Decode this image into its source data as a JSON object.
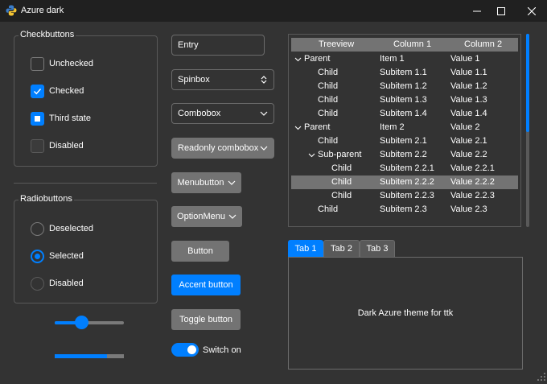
{
  "window": {
    "title": "Azure dark",
    "minimize": "—",
    "maximize": "☐",
    "close": "✕"
  },
  "checkbuttons": {
    "label": "Checkbuttons",
    "items": [
      {
        "label": "Unchecked",
        "state": "unchecked"
      },
      {
        "label": "Checked",
        "state": "checked"
      },
      {
        "label": "Third state",
        "state": "indeterminate"
      },
      {
        "label": "Disabled",
        "state": "disabled"
      }
    ]
  },
  "radiobuttons": {
    "label": "Radiobuttons",
    "items": [
      {
        "label": "Deselected",
        "state": "off"
      },
      {
        "label": "Selected",
        "state": "on"
      },
      {
        "label": "Disabled",
        "state": "disabled"
      }
    ]
  },
  "scale": {
    "value_fraction": 0.3
  },
  "progress": {
    "value_fraction": 0.75
  },
  "widgets": {
    "entry": "Entry",
    "spinbox": "Spinbox",
    "combobox": "Combobox",
    "readonly_combobox": "Readonly combobox",
    "menubutton": "Menubutton",
    "optionmenu": "OptionMenu",
    "button": "Button",
    "accent_button": "Accent button",
    "toggle_button": "Toggle button",
    "switch": "Switch on"
  },
  "treeview": {
    "headers": [
      "Treeview",
      "Column 1",
      "Column 2"
    ],
    "rows": [
      {
        "name": "Parent",
        "c1": "Item 1",
        "c2": "Value 1",
        "level": 0,
        "expander": true,
        "selected": false
      },
      {
        "name": "Child",
        "c1": "Subitem 1.1",
        "c2": "Value 1.1",
        "level": 1,
        "expander": false,
        "selected": false
      },
      {
        "name": "Child",
        "c1": "Subitem 1.2",
        "c2": "Value 1.2",
        "level": 1,
        "expander": false,
        "selected": false
      },
      {
        "name": "Child",
        "c1": "Subitem 1.3",
        "c2": "Value 1.3",
        "level": 1,
        "expander": false,
        "selected": false
      },
      {
        "name": "Child",
        "c1": "Subitem 1.4",
        "c2": "Value 1.4",
        "level": 1,
        "expander": false,
        "selected": false
      },
      {
        "name": "Parent",
        "c1": "Item 2",
        "c2": "Value 2",
        "level": 0,
        "expander": true,
        "selected": false
      },
      {
        "name": "Child",
        "c1": "Subitem 2.1",
        "c2": "Value 2.1",
        "level": 1,
        "expander": false,
        "selected": false
      },
      {
        "name": "Sub-parent",
        "c1": "Subitem 2.2",
        "c2": "Value 2.2",
        "level": 1,
        "expander": true,
        "selected": false
      },
      {
        "name": "Child",
        "c1": "Subitem 2.2.1",
        "c2": "Value 2.2.1",
        "level": 2,
        "expander": false,
        "selected": false
      },
      {
        "name": "Child",
        "c1": "Subitem 2.2.2",
        "c2": "Value 2.2.2",
        "level": 2,
        "expander": false,
        "selected": true
      },
      {
        "name": "Child",
        "c1": "Subitem 2.2.3",
        "c2": "Value 2.2.3",
        "level": 2,
        "expander": false,
        "selected": false
      },
      {
        "name": "Child",
        "c1": "Subitem 2.3",
        "c2": "Value 2.3",
        "level": 1,
        "expander": false,
        "selected": false
      }
    ]
  },
  "notebook": {
    "tabs": [
      {
        "label": "Tab 1",
        "active": true
      },
      {
        "label": "Tab 2",
        "active": false
      },
      {
        "label": "Tab 3",
        "active": false
      }
    ],
    "content": "Dark Azure theme for ttk"
  },
  "colors": {
    "accent": "#007fff",
    "background": "#333333",
    "titlebar": "#202020",
    "button": "#737373"
  }
}
